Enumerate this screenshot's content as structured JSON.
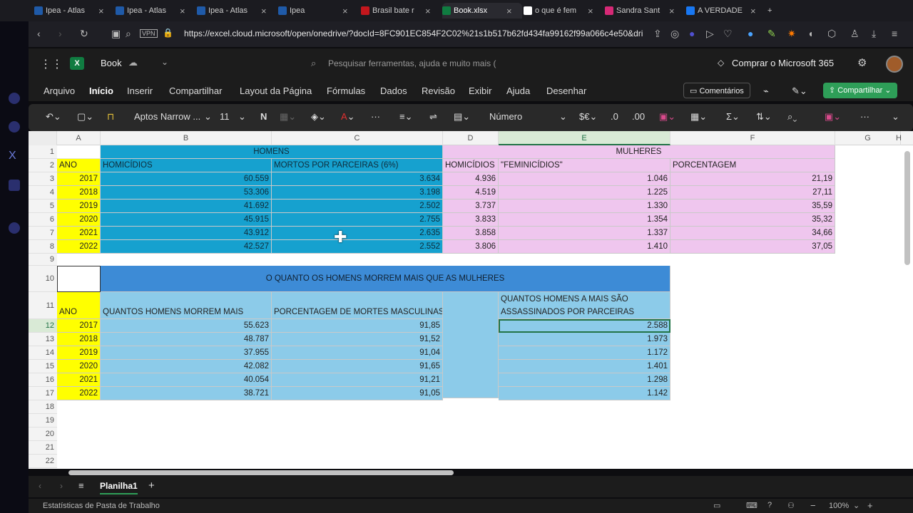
{
  "tabs": [
    {
      "label": "Ipea - Atlas",
      "color": "#1f5aa8"
    },
    {
      "label": "Ipea - Atlas",
      "color": "#1f5aa8"
    },
    {
      "label": "Ipea - Atlas",
      "color": "#1f5aa8"
    },
    {
      "label": "Ipea",
      "color": "#1f5aa8"
    },
    {
      "label": "Brasil bate r",
      "color": "#c4171d"
    },
    {
      "label": "Book.xlsx",
      "color": "#107c41"
    },
    {
      "label": "o que é fem",
      "color": "#ffffff"
    },
    {
      "label": "Sandra Sant",
      "color": "#d62976"
    },
    {
      "label": "A VERDADE",
      "color": "#1877f2"
    }
  ],
  "address": {
    "url": "https://excel.cloud.microsoft/open/onedrive/?docId=8FC901EC854F2C02%21s1b517b62fd434fa99162f99a066c4e50&dri",
    "vpn": "VPN"
  },
  "app": {
    "title": "Book",
    "search": "Pesquisar ferramentas, ajuda e muito mais (",
    "buy": "Comprar o Microsoft 365"
  },
  "menu": [
    "Arquivo",
    "Início",
    "Inserir",
    "Compartilhar",
    "Layout da Página",
    "Fórmulas",
    "Dados",
    "Revisão",
    "Exibir",
    "Ajuda",
    "Desenhar"
  ],
  "menu_right": {
    "comments": "Comentários",
    "share": "Compartilhar"
  },
  "toolbar": {
    "font": "Aptos Narrow ...",
    "size": "11",
    "bold": "N",
    "format": "Número"
  },
  "columns": [
    "A",
    "B",
    "C",
    "D",
    "E",
    "F",
    "G",
    "H"
  ],
  "rows": [
    "1",
    "2",
    "3",
    "4",
    "5",
    "6",
    "7",
    "8",
    "9",
    "10",
    "11",
    "12",
    "13",
    "14",
    "15",
    "16",
    "17",
    "18",
    "19",
    "20",
    "21",
    "22"
  ],
  "table1": {
    "homens": "HOMENS",
    "mulheres": "MULHERES",
    "headers": [
      "ANO",
      "HOMICÍDIOS",
      "MORTOS POR PARCEIRAS (6%)",
      "HOMICÍDIOS",
      "\"FEMINICÍDIOS\"",
      "PORCENTAGEM"
    ],
    "data": [
      [
        "2017",
        "60.559",
        "3.634",
        "4.936",
        "1.046",
        "21,19"
      ],
      [
        "2018",
        "53.306",
        "3.198",
        "4.519",
        "1.225",
        "27,11"
      ],
      [
        "2019",
        "41.692",
        "2.502",
        "3.737",
        "1.330",
        "35,59"
      ],
      [
        "2020",
        "45.915",
        "2.755",
        "3.833",
        "1.354",
        "35,32"
      ],
      [
        "2021",
        "43.912",
        "2.635",
        "3.858",
        "1.337",
        "34,66"
      ],
      [
        "2022",
        "42.527",
        "2.552",
        "3.806",
        "1.410",
        "37,05"
      ]
    ]
  },
  "table2": {
    "title": "O QUANTO OS HOMENS MORREM MAIS QUE AS MULHERES",
    "headers": [
      "ANO",
      "QUANTOS HOMENS MORREM MAIS",
      "PORCENTAGEM DE MORTES MASCULINAS"
    ],
    "data": [
      [
        "2017",
        "55.623",
        "91,85"
      ],
      [
        "2018",
        "48.787",
        "91,52"
      ],
      [
        "2019",
        "37.955",
        "91,04"
      ],
      [
        "2020",
        "42.082",
        "91,65"
      ],
      [
        "2021",
        "40.054",
        "91,21"
      ],
      [
        "2022",
        "38.721",
        "91,05"
      ]
    ]
  },
  "table3": {
    "header_line1": "QUANTOS HOMENS A MAIS SÃO",
    "header_line2": "ASSASSINADOS POR PARCEIRAS",
    "data": [
      "2.588",
      "1.973",
      "1.172",
      "1.401",
      "1.298",
      "1.142"
    ]
  },
  "sheet": {
    "name": "Planilha1",
    "add": "+"
  },
  "status": {
    "left": "Estatísticas de Pasta de Trabalho",
    "zoom": "100%"
  }
}
